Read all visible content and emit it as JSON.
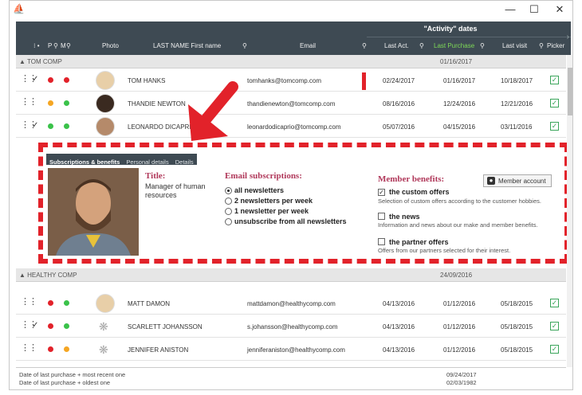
{
  "window": {
    "icon": "app-icon",
    "controls": {
      "minimize": "—",
      "maximize": "☐",
      "close": "✕"
    }
  },
  "header": {
    "group_label": "\"Activity\" dates",
    "columns": {
      "p": "P",
      "m": "M",
      "photo": "Photo",
      "name": "LAST NAME First name",
      "email": "Email",
      "last_act": "Last Act.",
      "last_purchase": "Last Purchase",
      "last_visit": "Last visit",
      "picker": "Picker"
    },
    "accent_color": "#7ed957",
    "bg_color": "#3e4a53"
  },
  "groups": [
    {
      "name": "TOM COMP",
      "date": "01/16/2017",
      "rows": [
        {
          "name": "TOM HANKS",
          "email": "tomhanks@tomcomp.com",
          "last_act": "02/24/2017",
          "last_purchase": "01/16/2017",
          "last_visit": "10/18/2017",
          "checked": "✓",
          "dot1": "#e2222a",
          "dot2": "#e2222a"
        },
        {
          "name": "THANDIE NEWTON",
          "email": "thandienewton@tomcomp.com",
          "last_act": "08/16/2016",
          "last_purchase": "12/24/2016",
          "last_visit": "12/21/2016",
          "checked": "",
          "dot1": "#f5a623",
          "dot2": "#3ac24a"
        },
        {
          "name": "LEONARDO DICAPRIO",
          "email": "leonardodicaprio@tomcomp.com",
          "last_act": "05/07/2016",
          "last_purchase": "04/15/2016",
          "last_visit": "03/11/2016",
          "checked": "✓",
          "dot1": "#3ac24a",
          "dot2": "#3ac24a"
        }
      ]
    },
    {
      "name": "HEALTHY COMP",
      "date": "24/09/2016",
      "rows": [
        {
          "name": "MATT DAMON",
          "email": "mattdamon@healthycomp.com",
          "last_act": "04/13/2016",
          "last_purchase": "01/12/2016",
          "last_visit": "05/18/2015",
          "checked": "",
          "dot1": "#e2222a",
          "dot2": "#3ac24a"
        },
        {
          "name": "SCARLETT JOHANSSON",
          "email": "s.johansson@healthycomp.com",
          "last_act": "04/13/2016",
          "last_purchase": "01/12/2016",
          "last_visit": "05/18/2015",
          "checked": "✓",
          "dot1": "#e2222a",
          "dot2": "#3ac24a"
        },
        {
          "name": "JENNIFER ANISTON",
          "email": "jenniferaniston@healthycomp.com",
          "last_act": "04/13/2016",
          "last_purchase": "01/12/2016",
          "last_visit": "05/18/2015",
          "checked": "",
          "dot1": "#e2222a",
          "dot2": "#f5a623"
        }
      ]
    }
  ],
  "detail": {
    "tabs": [
      "Subscriptions & benefits",
      "Personal details",
      "Details"
    ],
    "title_heading": "Title:",
    "title_value": "Manager of human resources",
    "email_heading": "Email subscriptions:",
    "email_options": [
      "all newsletters",
      "2 newsletters per week",
      "1 newsletter per week",
      "unsubscribe from all newsletters"
    ],
    "email_selected": "all newsletters",
    "benefits_heading": "Member benefits:",
    "member_button": "Member account",
    "benefits": [
      {
        "label": "the custom offers",
        "checked": true,
        "desc": "Selection of custom offers according to the customer hobbies."
      },
      {
        "label": "the news",
        "checked": false,
        "desc": "Information and news about our make and member benefits."
      },
      {
        "label": "the partner offers",
        "checked": false,
        "desc": "Offers from our partners selected for their interest."
      }
    ]
  },
  "footer": {
    "line1": "Date of last purchase + most recent one",
    "line2": "Date of last purchase + oldest one",
    "date1": "09/24/2017",
    "date2": "02/03/1982"
  },
  "highlight_color": "#e2222a"
}
